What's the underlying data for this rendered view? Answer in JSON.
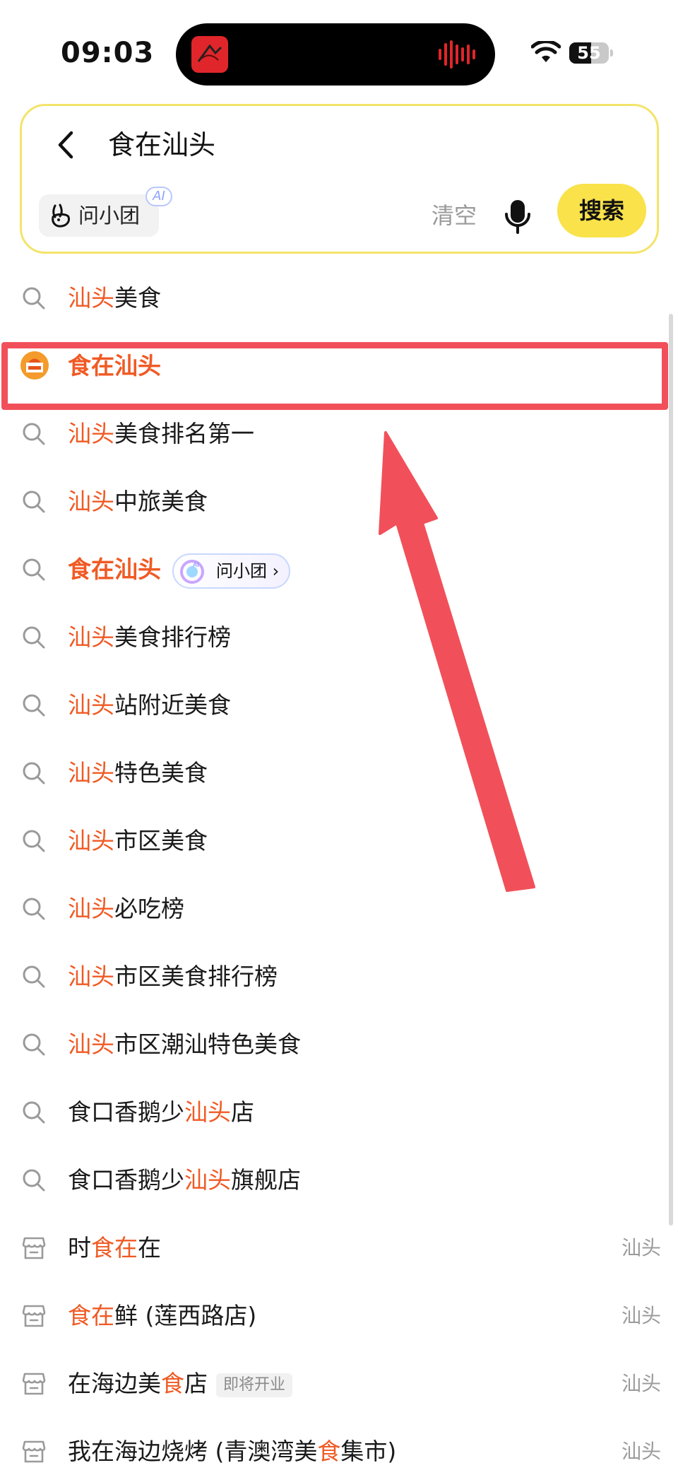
{
  "status_bar": {
    "time": "09:03",
    "battery_level": "55",
    "battery_fraction": 0.55
  },
  "search": {
    "query": "食在汕头",
    "ask_chip_label": "问小团",
    "ai_badge": "AI",
    "clear_label": "清空",
    "search_button": "搜索"
  },
  "colors": {
    "highlight": "#f05a24",
    "search_button": "#f9e24a",
    "card_border": "#f3e46a",
    "annotation_red": "#f1505a"
  },
  "suggestions": [
    {
      "icon": "search-icon",
      "parts": [
        {
          "t": "汕头",
          "h": true
        },
        {
          "t": "美食",
          "h": false
        }
      ]
    },
    {
      "icon": "coupon-icon",
      "parts": [
        {
          "t": "食在汕头",
          "h": true
        }
      ]
    },
    {
      "icon": "search-icon",
      "parts": [
        {
          "t": "汕头",
          "h": true
        },
        {
          "t": "美食排名第一",
          "h": false
        }
      ]
    },
    {
      "icon": "search-icon",
      "parts": [
        {
          "t": "汕头",
          "h": true
        },
        {
          "t": "中旅美食",
          "h": false
        }
      ]
    },
    {
      "icon": "search-icon",
      "parts": [
        {
          "t": "食在汕头",
          "h": true
        }
      ],
      "ask_pill": "问小团"
    },
    {
      "icon": "search-icon",
      "parts": [
        {
          "t": "汕头",
          "h": true
        },
        {
          "t": "美食排行榜",
          "h": false
        }
      ]
    },
    {
      "icon": "search-icon",
      "parts": [
        {
          "t": "汕头",
          "h": true
        },
        {
          "t": "站附近美食",
          "h": false
        }
      ]
    },
    {
      "icon": "search-icon",
      "parts": [
        {
          "t": "汕头",
          "h": true
        },
        {
          "t": "特色美食",
          "h": false
        }
      ]
    },
    {
      "icon": "search-icon",
      "parts": [
        {
          "t": "汕头",
          "h": true
        },
        {
          "t": "市区美食",
          "h": false
        }
      ]
    },
    {
      "icon": "search-icon",
      "parts": [
        {
          "t": "汕头",
          "h": true
        },
        {
          "t": "必吃榜",
          "h": false
        }
      ]
    },
    {
      "icon": "search-icon",
      "parts": [
        {
          "t": "汕头",
          "h": true
        },
        {
          "t": "市区美食排行榜",
          "h": false
        }
      ]
    },
    {
      "icon": "search-icon",
      "parts": [
        {
          "t": "汕头",
          "h": true
        },
        {
          "t": "市区潮汕特色美食",
          "h": false
        }
      ]
    },
    {
      "icon": "search-icon",
      "parts": [
        {
          "t": "食口香鹅少",
          "h": false
        },
        {
          "t": "汕头",
          "h": true
        },
        {
          "t": "店",
          "h": false
        }
      ]
    },
    {
      "icon": "search-icon",
      "parts": [
        {
          "t": "食口香鹅少",
          "h": false
        },
        {
          "t": "汕头",
          "h": true
        },
        {
          "t": "旗舰店",
          "h": false
        }
      ]
    },
    {
      "icon": "store-icon",
      "parts": [
        {
          "t": "时",
          "h": false
        },
        {
          "t": "食在",
          "h": true
        },
        {
          "t": "在",
          "h": false
        }
      ],
      "city": "汕头"
    },
    {
      "icon": "store-icon",
      "parts": [
        {
          "t": "食在",
          "h": true
        },
        {
          "t": "鲜 (莲西路店)",
          "h": false
        }
      ],
      "city": "汕头"
    },
    {
      "icon": "store-icon",
      "parts": [
        {
          "t": "在海边美",
          "h": false
        },
        {
          "t": "食",
          "h": true
        },
        {
          "t": "店",
          "h": false
        }
      ],
      "tag": "即将开业",
      "city": "汕头"
    },
    {
      "icon": "store-icon",
      "parts": [
        {
          "t": "我在海边烧烤 (青澳湾美",
          "h": false
        },
        {
          "t": "食",
          "h": true
        },
        {
          "t": "集市)",
          "h": false
        }
      ],
      "city": "汕头"
    }
  ]
}
